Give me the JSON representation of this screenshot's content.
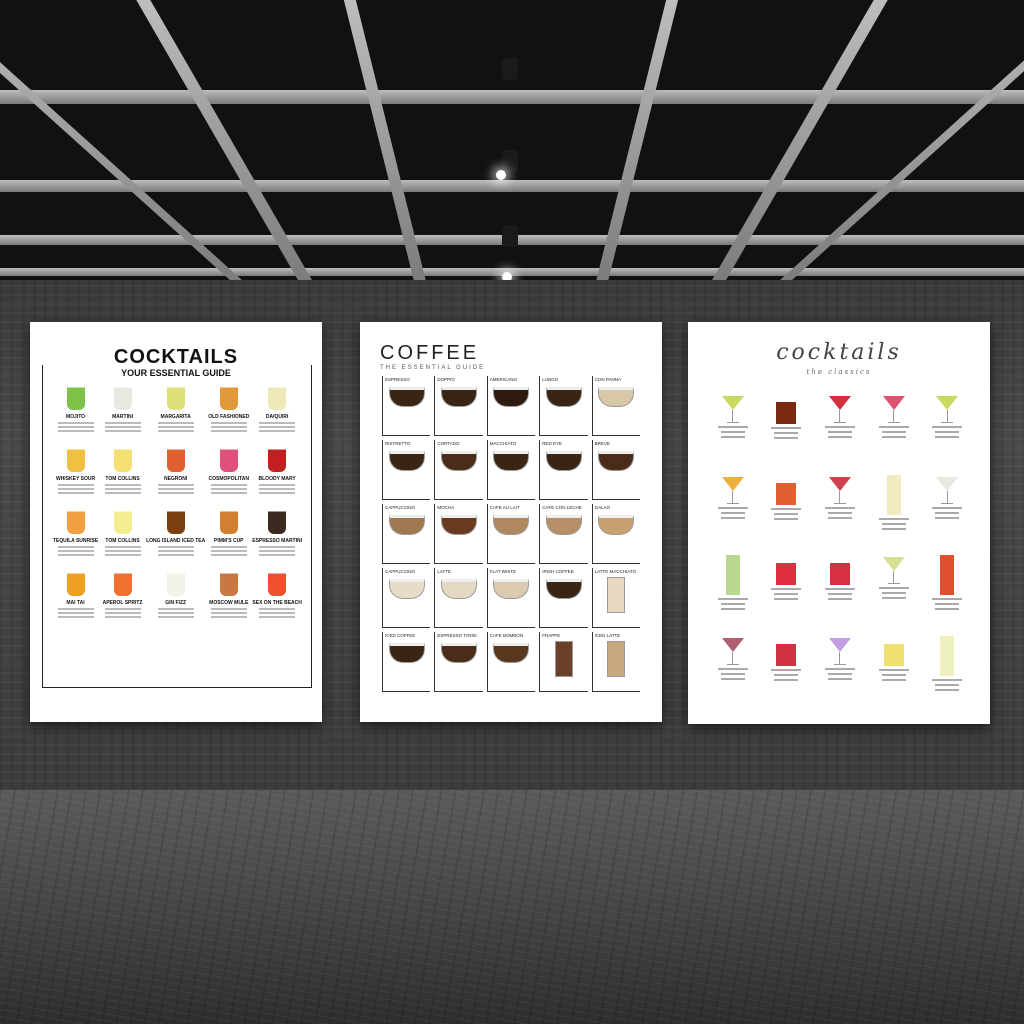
{
  "poster_left": {
    "title": "COCKTAILS",
    "subtitle": "YOUR ESSENTIAL GUIDE",
    "drinks": [
      {
        "name": "MOJITO",
        "color": "#7fc24a"
      },
      {
        "name": "MARTINI",
        "color": "#e8e8e0"
      },
      {
        "name": "MARGARITA",
        "color": "#e0e07a"
      },
      {
        "name": "OLD FASHIONED",
        "color": "#e09a3a"
      },
      {
        "name": "DAIQUIRI",
        "color": "#ece8b8"
      },
      {
        "name": "WHISKEY SOUR",
        "color": "#f0c040"
      },
      {
        "name": "TOM COLLINS",
        "color": "#f2e070"
      },
      {
        "name": "NEGRONI",
        "color": "#e06030"
      },
      {
        "name": "COSMOPOLITAN",
        "color": "#e0507a"
      },
      {
        "name": "BLOODY MARY",
        "color": "#c02020"
      },
      {
        "name": "TEQUILA SUNRISE",
        "color": "#f0a040"
      },
      {
        "name": "TOM COLLINS",
        "color": "#f4ec90"
      },
      {
        "name": "LONG ISLAND ICED TEA",
        "color": "#7a4010"
      },
      {
        "name": "PIMM'S CUP",
        "color": "#d08030"
      },
      {
        "name": "ESPRESSO MARTINI",
        "color": "#3a2a20"
      },
      {
        "name": "MAI TAI",
        "color": "#f0a020"
      },
      {
        "name": "APEROL SPRITZ",
        "color": "#f07030"
      },
      {
        "name": "GIN FIZZ",
        "color": "#f2f2ea"
      },
      {
        "name": "MOSCOW MULE",
        "color": "#c87840"
      },
      {
        "name": "SEX ON THE BEACH",
        "color": "#f05030"
      }
    ]
  },
  "poster_middle": {
    "title": "COFFEE",
    "subtitle": "THE ESSENTIAL GUIDE",
    "drinks": [
      {
        "name": "ESPRESSO",
        "color": "#3a2414"
      },
      {
        "name": "DOPPIO",
        "color": "#3a2414"
      },
      {
        "name": "AMERICANO",
        "color": "#2e1a0e"
      },
      {
        "name": "LUNGO",
        "color": "#3a2414"
      },
      {
        "name": "CON PANNA",
        "color": "#d8c8a8"
      },
      {
        "name": "RISTRETTO",
        "color": "#3a2414"
      },
      {
        "name": "CORTADO",
        "color": "#4a2c18"
      },
      {
        "name": "MACCHIATO",
        "color": "#3a2414"
      },
      {
        "name": "RED EYE",
        "color": "#3a2414"
      },
      {
        "name": "BREVE",
        "color": "#4a2c18"
      },
      {
        "name": "CAPPUCCINO",
        "color": "#a07850"
      },
      {
        "name": "MOCHA",
        "color": "#6a3a20"
      },
      {
        "name": "CAFE AU LAIT",
        "color": "#b08860"
      },
      {
        "name": "CAFE CON LECHE",
        "color": "#b89068"
      },
      {
        "name": "GALAO",
        "color": "#c8a070"
      },
      {
        "name": "CAPPUCCINO",
        "color": "#e8dcc8"
      },
      {
        "name": "LATTE",
        "color": "#e4d8c0"
      },
      {
        "name": "FLAT WHITE",
        "color": "#dccab0"
      },
      {
        "name": "IRISH COFFEE",
        "color": "#3a2414"
      },
      {
        "name": "LATTE MACCHIATO",
        "color": "#e8d8c0"
      },
      {
        "name": "ICED COFFEE",
        "color": "#3a2414"
      },
      {
        "name": "ESPRESSO TONIC",
        "color": "#4a2c18"
      },
      {
        "name": "CAFE BOMBON",
        "color": "#5a3820"
      },
      {
        "name": "FRAPPE",
        "color": "#6a4028"
      },
      {
        "name": "ICED LATTE",
        "color": "#c8a880"
      }
    ]
  },
  "poster_right": {
    "title": "cocktails",
    "subtitle": "the classics",
    "drinks": [
      {
        "shape": "martini",
        "color": "#c8d860"
      },
      {
        "shape": "rocks",
        "color": "#7a2a10"
      },
      {
        "shape": "martini",
        "color": "#d03040"
      },
      {
        "shape": "martini",
        "color": "#e05070"
      },
      {
        "shape": "martini",
        "color": "#c8d860"
      },
      {
        "shape": "martini",
        "color": "#f0b040"
      },
      {
        "shape": "rocks",
        "color": "#e06030"
      },
      {
        "shape": "martini",
        "color": "#d04050"
      },
      {
        "shape": "highball",
        "color": "#f0ecc0"
      },
      {
        "shape": "martini",
        "color": "#e8e8e0"
      },
      {
        "shape": "highball",
        "color": "#b8d890"
      },
      {
        "shape": "rocks",
        "color": "#e03040"
      },
      {
        "shape": "rocks",
        "color": "#d83040"
      },
      {
        "shape": "martini",
        "color": "#d8e090"
      },
      {
        "shape": "highball",
        "color": "#e05030"
      },
      {
        "shape": "martini",
        "color": "#b06070"
      },
      {
        "shape": "rocks",
        "color": "#d03040"
      },
      {
        "shape": "martini",
        "color": "#c0a0e0"
      },
      {
        "shape": "rocks",
        "color": "#f0e070"
      },
      {
        "shape": "highball",
        "color": "#eef0c0"
      }
    ]
  }
}
